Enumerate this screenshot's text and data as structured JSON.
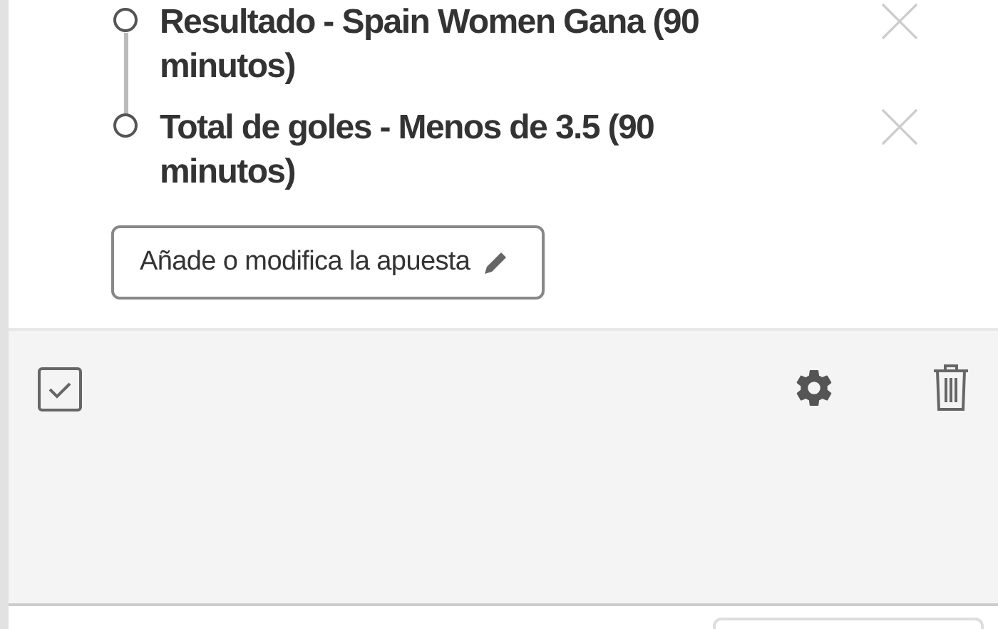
{
  "selections": [
    {
      "label": "Resultado - Spain Women Gana (90 minutos)"
    },
    {
      "label": "Total de goles - Menos de 3.5 (90 minutos)"
    }
  ],
  "edit_button": {
    "label": "Añade o modifica la apuesta"
  }
}
